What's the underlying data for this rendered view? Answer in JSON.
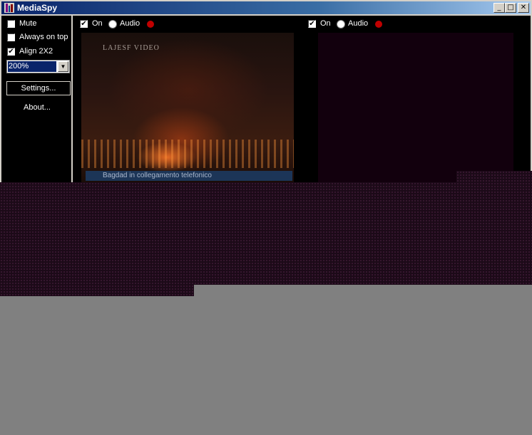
{
  "window": {
    "title": "MediaSpy",
    "controls": {
      "minimize": "_",
      "maximize": "□",
      "close": "✕"
    }
  },
  "sidebar": {
    "mute_label": "Mute",
    "mute_checked": false,
    "always_on_top_label": "Always on top",
    "always_on_top_checked": false,
    "align_label": "Align 2X2",
    "align_checked": true,
    "zoom_value": "200%",
    "settings_label": "Settings...",
    "about_label": "About..."
  },
  "panel1": {
    "on_label": "On",
    "on_checked": true,
    "audio_label": "Audio",
    "video_watermark": "LAJESF VIDEO",
    "video_caption": "Bagdad in collegamento telefonico"
  },
  "panel2": {
    "on_label": "On",
    "on_checked": true,
    "audio_label": "Audio"
  },
  "colors": {
    "titlebar": "#0a246a",
    "record": "#c00000",
    "noise": "#1c0a18"
  },
  "icons": {
    "app": "app-icon",
    "check": "check-icon",
    "dropdown": "chevron-down-icon",
    "record": "record-indicator-icon"
  }
}
